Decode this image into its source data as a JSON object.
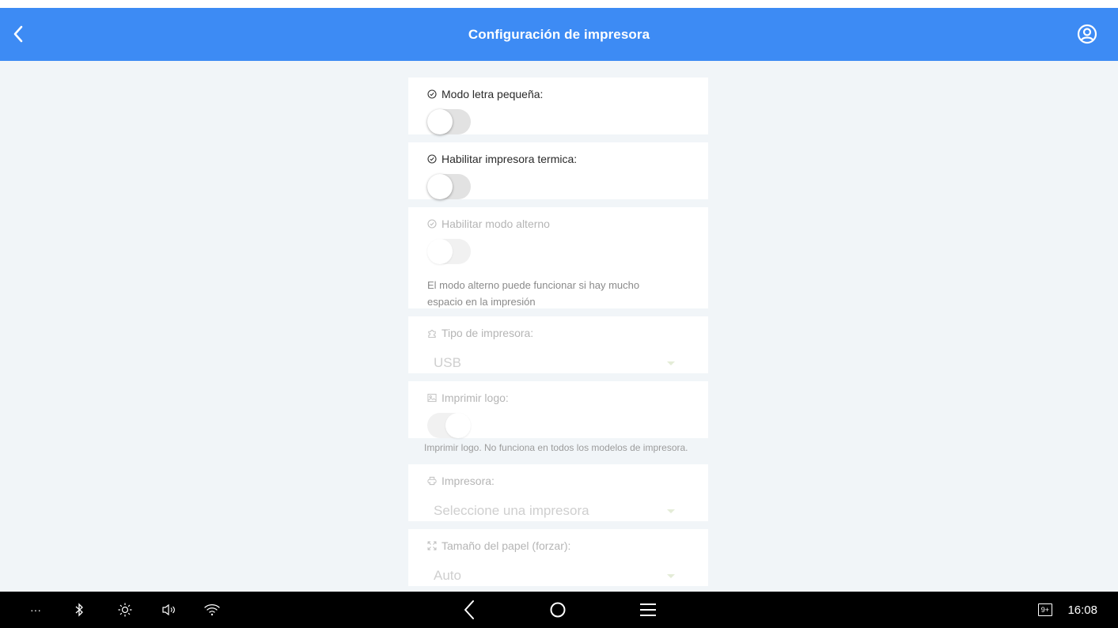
{
  "header": {
    "title": "Configuración de impresora"
  },
  "settings": {
    "small_font": {
      "label": "Modo letra pequeña:",
      "enabled": false
    },
    "thermal_printer": {
      "label": "Habilitar impresora termica:",
      "enabled": false
    },
    "alternate_mode": {
      "label": "Habilitar modo alterno",
      "enabled": false,
      "help_line1": "El modo alterno puede funcionar si hay mucho",
      "help_line2": "espacio en la impresión"
    },
    "printer_type": {
      "label": "Tipo de impresora:",
      "value": "USB"
    },
    "print_logo": {
      "label": "Imprimir logo:",
      "enabled": true,
      "help": "Imprimir logo. No funciona en todos los modelos de impresora."
    },
    "printer": {
      "label": "Impresora:",
      "placeholder": "Seleccione una impresora"
    },
    "paper_size": {
      "label": "Tamaño del papel (forzar):",
      "value": "Auto"
    }
  },
  "system_bar": {
    "more": "···",
    "badge": "9+",
    "time": "16:08"
  },
  "colors": {
    "header": "#3d8bf4",
    "content_bg": "#f1f5f8",
    "navbar": "#000000"
  }
}
